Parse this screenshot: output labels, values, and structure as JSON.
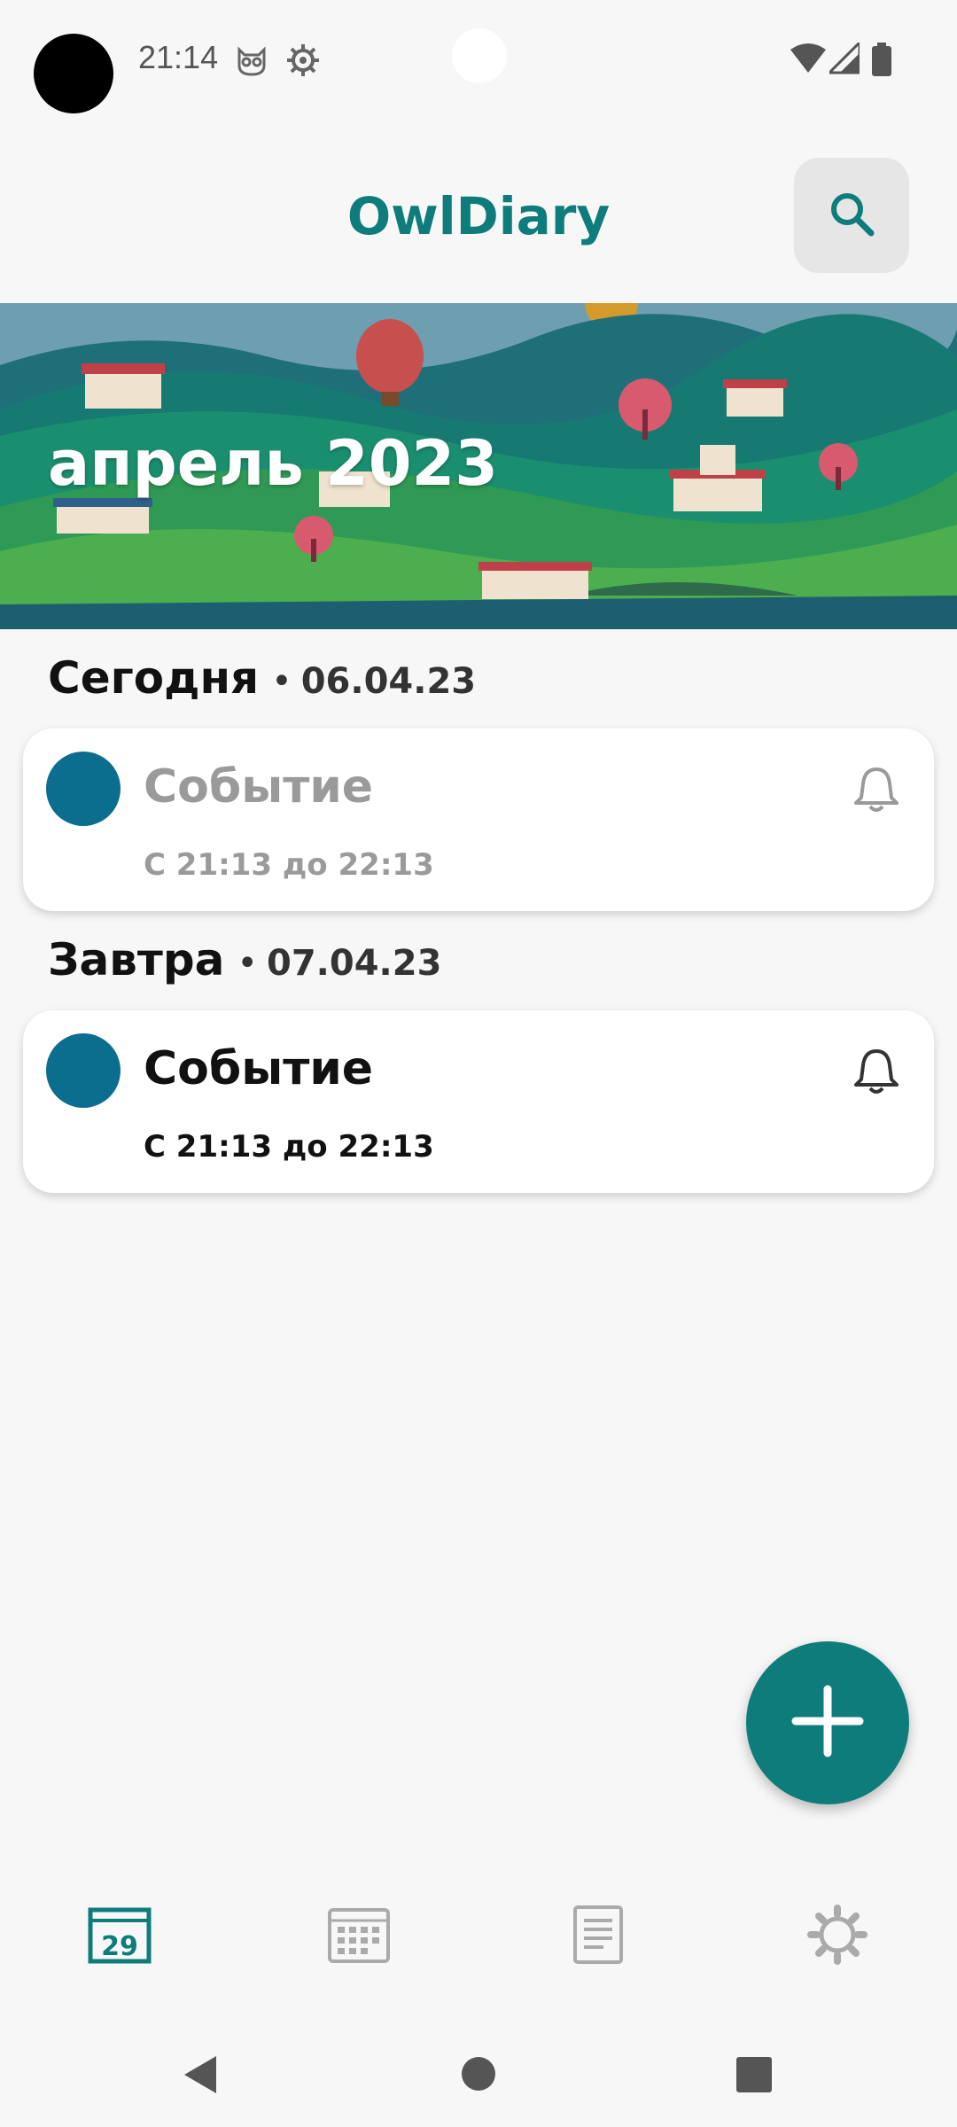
{
  "status_bar": {
    "time": "21:14"
  },
  "header": {
    "title": "OwlDiary",
    "search_icon": "search-icon"
  },
  "banner": {
    "month_label": "апрель 2023"
  },
  "sections": [
    {
      "day": "Сегодня",
      "date": "06.04.23",
      "events": [
        {
          "title": "Событие",
          "time": "С 21:13 до 22:13",
          "color": "#0b6e8e",
          "muted": true
        }
      ]
    },
    {
      "day": "Завтра",
      "date": "07.04.23",
      "events": [
        {
          "title": "Событие",
          "time": "С 21:13 до 22:13",
          "color": "#0b6e8e",
          "muted": false
        }
      ]
    }
  ],
  "separator": "•",
  "bottom_nav": {
    "items": [
      {
        "icon": "day-calendar-icon",
        "label": "29",
        "active": true
      },
      {
        "icon": "month-calendar-icon",
        "active": false
      },
      {
        "icon": "notes-icon",
        "active": false
      },
      {
        "icon": "settings-gear-icon",
        "active": false
      }
    ]
  },
  "colors": {
    "accent": "#0e7c7b",
    "event": "#0b6e8e",
    "background": "#f7f7f7"
  }
}
